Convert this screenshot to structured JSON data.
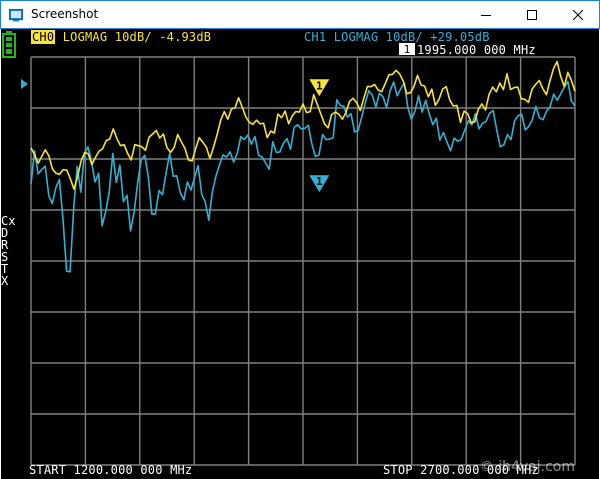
{
  "window": {
    "title": "Screenshot",
    "controls": {
      "minimize": "minimize",
      "maximize": "maximize",
      "close": "close"
    }
  },
  "trace_header": {
    "ch0_tag": "CH0",
    "ch0_text": "LOGMAG 10dB/ -4.93dB",
    "ch1_text": "CH1 LOGMAG 10dB/ +29.05dB"
  },
  "marker": {
    "icon": "marker-1-badge",
    "number": "1",
    "freq": "1995.000 000 MHz"
  },
  "side_menu": [
    "Cx",
    "D",
    "R",
    "S",
    "T",
    "X"
  ],
  "footer": {
    "start": "START 1200.000 000 MHz",
    "stop": "STOP 2700.000 000 MHz"
  },
  "watermark": "© jh4vaj.com",
  "colors": {
    "ch0": "#f8e338",
    "ch1": "#33b1d3",
    "grid": "#808080",
    "background": "#000000",
    "battery": "#21b521"
  },
  "chart_data": {
    "type": "line",
    "xlim": [
      1200,
      2700
    ],
    "ylim": [
      -80,
      0
    ],
    "x_divisions": 10,
    "y_divisions": 8,
    "series": [
      {
        "name": "CH0",
        "color": "#f8e338",
        "values": [
          -17.8,
          -19.2,
          -20.8,
          -19.5,
          -18.2,
          -19.4,
          -22.0,
          -22.8,
          -23.0,
          -22.1,
          -22.2,
          -23.9,
          -25.9,
          -23.5,
          -20.4,
          -18.7,
          -19.0,
          -21.1,
          -19.7,
          -18.5,
          -18.0,
          -16.4,
          -16.1,
          -14.1,
          -16.0,
          -17.4,
          -17.2,
          -18.9,
          -20.2,
          -17.2,
          -17.4,
          -17.6,
          -18.3,
          -15.7,
          -15.1,
          -14.4,
          -15.9,
          -15.1,
          -17.8,
          -18.7,
          -17.7,
          -15.2,
          -16.6,
          -17.9,
          -20.2,
          -20.4,
          -18.0,
          -15.8,
          -16.7,
          -17.7,
          -19.9,
          -17.7,
          -15.2,
          -12.4,
          -10.7,
          -12.2,
          -10.2,
          -10.0,
          -8.0,
          -9.8,
          -11.7,
          -12.8,
          -13.2,
          -12.4,
          -13.1,
          -13.0,
          -15.8,
          -14.5,
          -14.9,
          -11.2,
          -11.9,
          -10.6,
          -13.1,
          -11.5,
          -10.7,
          -10.8,
          -9.2,
          -10.9,
          -10.7,
          -7.4,
          -9.3,
          -11.2,
          -13.1,
          -13.9,
          -11.3,
          -10.8,
          -11.2,
          -12.2,
          -10.9,
          -8.7,
          -8.1,
          -9.0,
          -10.5,
          -8.1,
          -5.8,
          -5.8,
          -5.4,
          -6.5,
          -6.8,
          -5.2,
          -3.5,
          -3.4,
          -2.6,
          -3.3,
          -4.7,
          -7.2,
          -7.0,
          -5.8,
          -3.6,
          -5.5,
          -5.7,
          -7.8,
          -6.3,
          -9.5,
          -8.3,
          -6.3,
          -5.8,
          -8.4,
          -9.6,
          -9.5,
          -12.8,
          -10.6,
          -11.1,
          -12.9,
          -12.7,
          -10.2,
          -9.2,
          -10.4,
          -7.3,
          -5.9,
          -6.8,
          -5.1,
          -6.4,
          -3.3,
          -6.4,
          -6.0,
          -5.9,
          -8.2,
          -8.3,
          -8.9,
          -6.3,
          -5.4,
          -4.6,
          -6.2,
          -7.4,
          -4.7,
          -2.3,
          -0.9,
          -3.8,
          -5.8,
          -3.0,
          -4.6,
          -6.7
        ]
      },
      {
        "name": "CH1",
        "color": "#33b1d3",
        "values": [
          -24.9,
          -18.4,
          -22.9,
          -22.1,
          -21.4,
          -27.2,
          -28.7,
          -25.6,
          -24.0,
          -31.8,
          -42.0,
          -42.1,
          -29.6,
          -21.5,
          -26.5,
          -19.0,
          -17.6,
          -20.3,
          -24.5,
          -22.8,
          -33.1,
          -30.3,
          -26.5,
          -18.9,
          -24.6,
          -21.2,
          -28.4,
          -27.1,
          -34.1,
          -30.4,
          -24.6,
          -20.1,
          -19.3,
          -23.5,
          -30.8,
          -30.8,
          -26.2,
          -27.0,
          -22.7,
          -18.9,
          -23.4,
          -23.3,
          -26.6,
          -28.0,
          -24.5,
          -26.1,
          -23.6,
          -21.3,
          -26.9,
          -28.4,
          -32.0,
          -26.5,
          -23.4,
          -21.2,
          -19.2,
          -19.6,
          -18.6,
          -20.6,
          -18.9,
          -15.6,
          -16.2,
          -15.3,
          -17.1,
          -15.6,
          -19.3,
          -19.6,
          -20.8,
          -22.0,
          -16.6,
          -18.7,
          -18.6,
          -16.9,
          -16.0,
          -18.1,
          -13.8,
          -13.3,
          -14.1,
          -14.0,
          -13.4,
          -17.1,
          -19.5,
          -19.2,
          -15.2,
          -16.2,
          -16.1,
          -15.8,
          -8.4,
          -9.5,
          -9.7,
          -11.8,
          -11.1,
          -14.7,
          -14.4,
          -11.8,
          -9.0,
          -6.6,
          -7.5,
          -9.8,
          -7.1,
          -7.8,
          -9.9,
          -6.6,
          -4.9,
          -7.6,
          -6.2,
          -5.1,
          -10.0,
          -12.2,
          -10.6,
          -7.6,
          -10.8,
          -8.5,
          -11.1,
          -13.3,
          -12.0,
          -16.3,
          -14.8,
          -16.7,
          -18.4,
          -15.9,
          -16.5,
          -16.2,
          -14.3,
          -12.5,
          -13.3,
          -11.1,
          -14.1,
          -13.0,
          -12.6,
          -11.0,
          -10.5,
          -14.4,
          -17.6,
          -17.2,
          -15.2,
          -16.2,
          -12.5,
          -11.5,
          -11.2,
          -14.3,
          -13.6,
          -12.3,
          -9.7,
          -11.9,
          -12.3,
          -10.6,
          -9.7,
          -7.3,
          -8.5,
          -7.2,
          -5.9,
          -4.8,
          -8.6,
          -9.6
        ]
      }
    ],
    "markers": [
      {
        "label": "1",
        "x": 1995,
        "series": "CH0",
        "y": -8.1,
        "color": "#f8e338"
      },
      {
        "label": "1",
        "x": 1995,
        "series": "CH1",
        "y": -26.9,
        "color": "#33b1d3"
      }
    ]
  }
}
